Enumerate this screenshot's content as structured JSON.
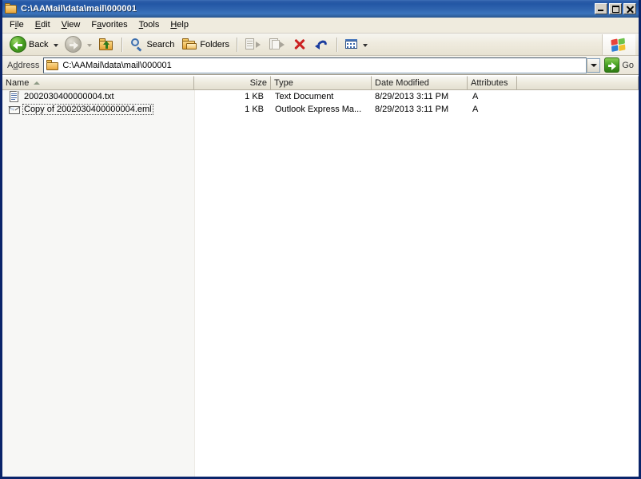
{
  "window": {
    "title": "C:\\AAMail\\data\\mail\\000001",
    "title_icon": "folder-icon",
    "minimize_label": "Minimize",
    "maximize_label": "Maximize",
    "close_label": "Close"
  },
  "menu": {
    "items": [
      {
        "pre": "F",
        "key": "i",
        "post": "le",
        "full": "File"
      },
      {
        "pre": "",
        "key": "E",
        "post": "dit",
        "full": "Edit"
      },
      {
        "pre": "",
        "key": "V",
        "post": "iew",
        "full": "View"
      },
      {
        "pre": "F",
        "key": "a",
        "post": "vorites",
        "full": "Favorites"
      },
      {
        "pre": "",
        "key": "T",
        "post": "ools",
        "full": "Tools"
      },
      {
        "pre": "",
        "key": "H",
        "post": "elp",
        "full": "Help"
      }
    ]
  },
  "toolbar": {
    "back_label": "Back",
    "forward_label": "",
    "up_label": "Up",
    "search_label": "Search",
    "folders_label": "Folders",
    "move_to_label": "Move To",
    "copy_to_label": "Copy To",
    "delete_label": "Delete",
    "undo_label": "Undo",
    "views_label": "Views",
    "windows_flag": "windows-logo"
  },
  "address": {
    "label_pre": "A",
    "label_key": "d",
    "label_post": "dress",
    "value": "C:\\AAMail\\data\\mail\\000001",
    "icon": "folder-icon",
    "go_label": "Go"
  },
  "columns": [
    {
      "id": "name",
      "label": "Name",
      "sorted": "asc"
    },
    {
      "id": "size",
      "label": "Size",
      "sorted": ""
    },
    {
      "id": "type",
      "label": "Type",
      "sorted": ""
    },
    {
      "id": "date",
      "label": "Date Modified",
      "sorted": ""
    },
    {
      "id": "attributes",
      "label": "Attributes",
      "sorted": ""
    }
  ],
  "files": [
    {
      "name": "2002030400000004.txt",
      "size": "1 KB",
      "type": "Text Document",
      "date_modified": "8/29/2013 3:11 PM",
      "attributes": "A",
      "icon": "text-document-icon",
      "focused": false
    },
    {
      "name": "Copy of 2002030400000004.eml",
      "size": "1 KB",
      "type": "Outlook Express Ma...",
      "date_modified": "8/29/2013 3:11 PM",
      "attributes": "A",
      "icon": "mail-envelope-icon",
      "focused": true
    }
  ],
  "colors": {
    "titlebar_blue": "#2357a5",
    "chrome": "#efebde",
    "accent_green": "#46a021",
    "delete_red": "#cc2222",
    "undo_blue": "#1b3d9e"
  }
}
